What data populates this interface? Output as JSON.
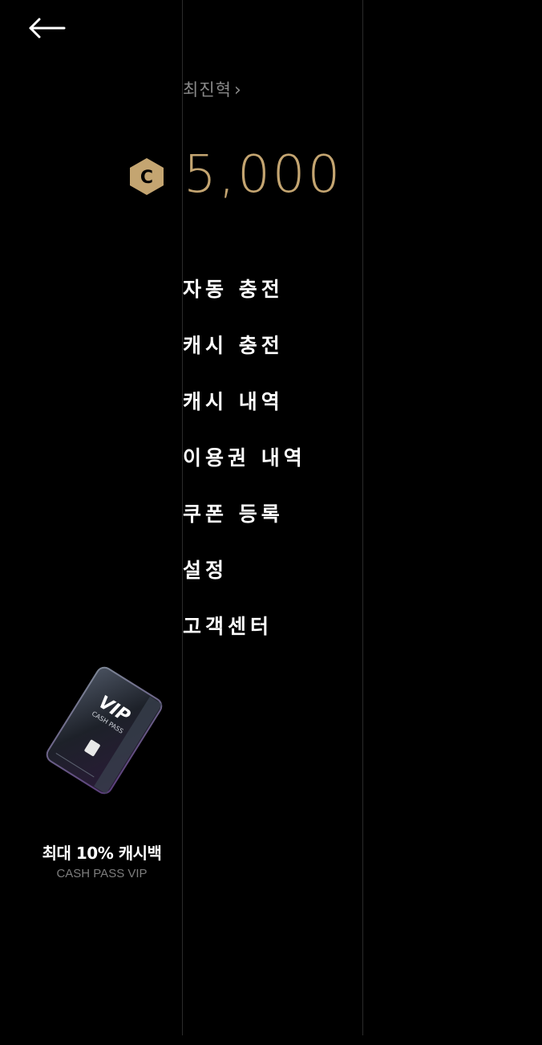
{
  "header": {
    "back_icon": "arrow-left-icon"
  },
  "profile": {
    "name": "최진혁",
    "chevron": "›"
  },
  "wallet": {
    "coin_icon": "cash-coin-icon",
    "coin_letter": "C",
    "balance": "5,000",
    "accent_color": "#c4a571"
  },
  "menu": {
    "items": [
      {
        "label": "자동 충전"
      },
      {
        "label": "캐시 충전"
      },
      {
        "label": "캐시 내역"
      },
      {
        "label": "이용권 내역"
      },
      {
        "label": "쿠폰 등록"
      },
      {
        "label": "설정"
      },
      {
        "label": "고객센터"
      }
    ]
  },
  "promo": {
    "card_icon": "vip-card-icon",
    "card_title": "VIP",
    "card_subtitle": "CASH PASS",
    "title": "최대 10% 캐시백",
    "subtitle": "CASH PASS VIP"
  }
}
